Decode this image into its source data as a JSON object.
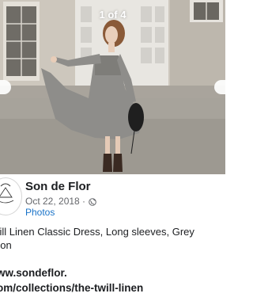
{
  "viewer": {
    "counter": "1 of 4"
  },
  "post": {
    "page_name": "Son de Flor",
    "date": "Oct 22, 2018 ·",
    "privacy_icon": "globe-icon",
    "album": "Photos",
    "caption_line1": "vill Linen Classic Dress, Long sleeves, Grey",
    "caption_line2": "oon",
    "link_line1": "ww.sondeflor.",
    "link_line2": "om/collections/the-twill-linen"
  },
  "colors": {
    "link_blue": "#1a73c8",
    "meta_grey": "#65676b",
    "text": "#1c1e21"
  }
}
